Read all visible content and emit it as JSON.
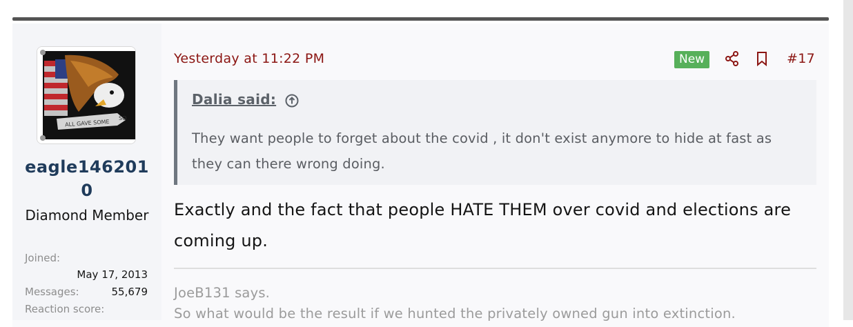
{
  "post": {
    "timestamp": "Yesterday at 11:22 PM",
    "new_badge": "New",
    "post_number": "#17",
    "user": {
      "username": "eagle1462010",
      "title": "Diamond Member",
      "stats": [
        {
          "label": "Joined:",
          "value": "May 17, 2013"
        },
        {
          "label": "Messages:",
          "value": "55,679"
        },
        {
          "label": "Reaction score:",
          "value": ""
        }
      ]
    },
    "quote": {
      "author": "Dalia said:",
      "text": "They want people to forget about the covid , it don't exist anymore to hide at fast as they can there wrong doing."
    },
    "message": "Exactly and the fact that people HATE THEM over covid and elections are coming up.",
    "signature": {
      "line1": "JoeB131 says.",
      "line2": "So what would be the result if we hunted the privately owned gun into extinction."
    }
  },
  "icons": {
    "share": "share-icon",
    "bookmark": "bookmark-icon",
    "quote_jump": "arrow-up-circle-icon"
  },
  "colors": {
    "accent": "#8b1512",
    "username": "#1f3b5b",
    "badge": "#57b05a"
  }
}
